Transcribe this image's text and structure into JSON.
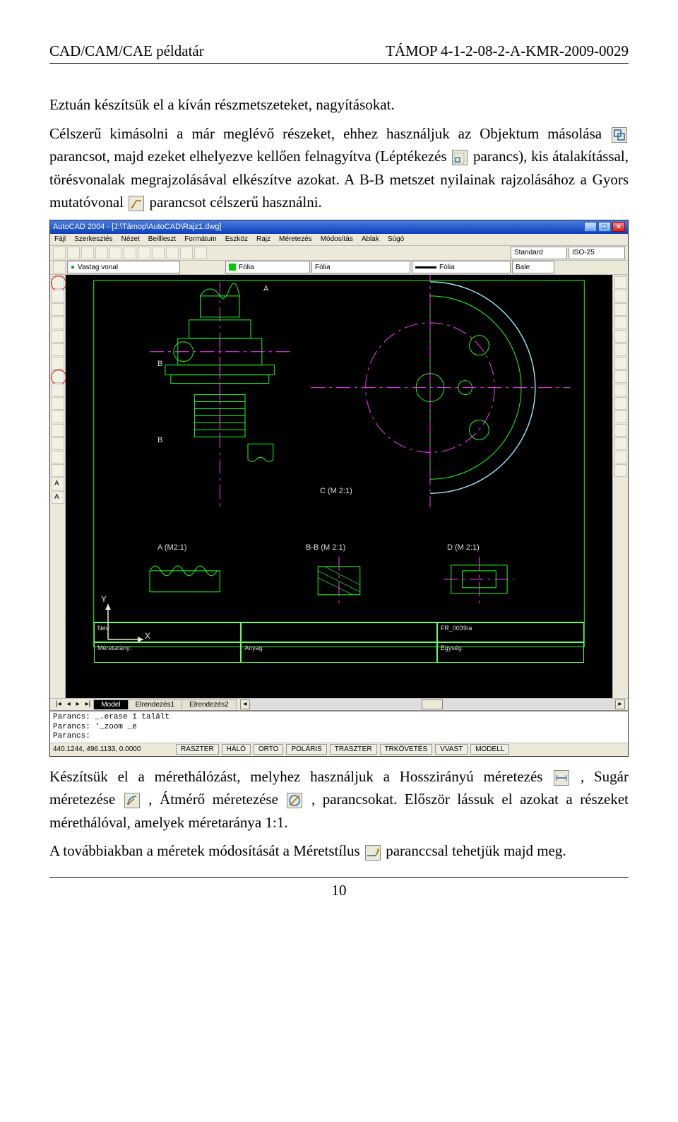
{
  "header": {
    "left": "CAD/CAM/CAE példatár",
    "right": "TÁMOP 4-1-2-08-2-A-KMR-2009-0029"
  },
  "para1": "Eztuán készítsük el a kíván részmetszeteket, nagyításokat.",
  "para2a": "Célszerű kimásolni a már meglévő részeket, ehhez használjuk az Objektum másolása ",
  "para2b": " parancsot, majd ezeket elhelyezve kellően felnagyítva (Léptékezés ",
  "para2c": " parancs), kis átalakítással, törésvonalak megrajzolásával elkészítve azokat. A B-B metszet nyilainak rajzolásához a Gyors mutatóvonal ",
  "para2d": " parancsot célszerű használni.",
  "para3a": "Készítsük el a mérethálózást, melyhez használjuk a Hosszirányú méretezés ",
  "para3b": ", Sugár méretezése ",
  "para3c": ", Átmérő méretezése ",
  "para3d": ", parancsokat. Először lássuk el azokat a részeket mérethálóval, amelyek méretaránya 1:1.",
  "para4a": "A továbbiakban a méretek módosítását a Méretstílus ",
  "para4b": " paranccsal tehetjük majd meg.",
  "page_number": "10",
  "acad": {
    "title": "AutoCAD 2004 - [J:\\Tämop\\AutoCAD\\Rajz1.dwg]",
    "menus": [
      "Fájl",
      "Szerkesztés",
      "Nézet",
      "Beillleszt",
      "Formátum",
      "Eszköz",
      "Rajz",
      "Méretezés",
      "Módosítás",
      "Ablak",
      "Súgó"
    ],
    "dd_standard": "Standard",
    "dd_iso": "ISO-25",
    "layer_current": "Vastag vonal",
    "folia": "Fólia",
    "bale": "Bale",
    "labels": {
      "A": "A",
      "B": "B",
      "B2": "B",
      "C": "C (M 2:1)",
      "Am": "A (M2:1)",
      "BB": "B-B (M 2:1)",
      "Dm": "D (M 2:1)"
    },
    "titleblock": {
      "nev": "Név:",
      "meret": "Méretarány:",
      "anyag": "Anyag",
      "rajzszam": "FR_0039/a",
      "egyes": "Egység"
    },
    "tabs": [
      "Model",
      "Elrendezés1",
      "Elrendezés2"
    ],
    "cmd1": "Parancs: _.erase 1 talált",
    "cmd2": "Parancs: '_zoom _e",
    "cmd3": "Parancs:",
    "coords": "440.1244, 496.1133, 0.0000",
    "status": [
      "RASZTER",
      "HÁLÓ",
      "ORTO",
      "POLÁRIS",
      "TRASZTER",
      "TRKÖVETÉS",
      "VVAST",
      "MODELL"
    ],
    "ucs": {
      "x": "X",
      "y": "Y"
    }
  },
  "icons": {
    "copy": "copy-icon",
    "scale": "scale-icon",
    "leader": "leader-icon",
    "lindim": "linear-dim-icon",
    "raddim": "radius-dim-icon",
    "diadim": "diameter-dim-icon",
    "dimstyle": "dimstyle-icon"
  }
}
